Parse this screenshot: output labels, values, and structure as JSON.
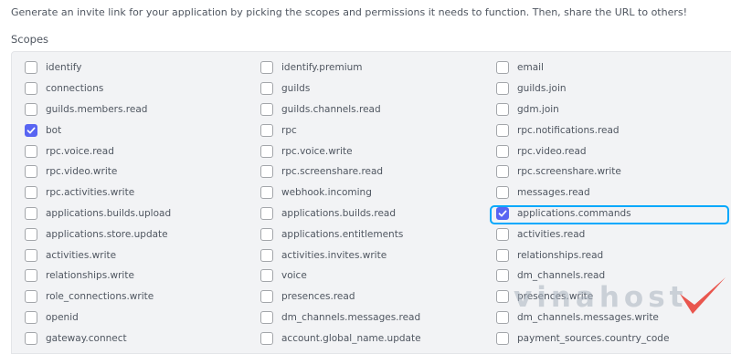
{
  "intro_text": "Generate an invite link for your application by picking the scopes and permissions it needs to function. Then, share the URL to others!",
  "scopes_label": "Scopes",
  "colors": {
    "accent": "#5865f2",
    "focus_ring": "#00a8fc",
    "watermark_check": "#e8453c"
  },
  "scopes": [
    {
      "label": "identify",
      "checked": false
    },
    {
      "label": "identify.premium",
      "checked": false
    },
    {
      "label": "email",
      "checked": false
    },
    {
      "label": "connections",
      "checked": false
    },
    {
      "label": "guilds",
      "checked": false
    },
    {
      "label": "guilds.join",
      "checked": false
    },
    {
      "label": "guilds.members.read",
      "checked": false
    },
    {
      "label": "guilds.channels.read",
      "checked": false
    },
    {
      "label": "gdm.join",
      "checked": false
    },
    {
      "label": "bot",
      "checked": true
    },
    {
      "label": "rpc",
      "checked": false
    },
    {
      "label": "rpc.notifications.read",
      "checked": false
    },
    {
      "label": "rpc.voice.read",
      "checked": false
    },
    {
      "label": "rpc.voice.write",
      "checked": false
    },
    {
      "label": "rpc.video.read",
      "checked": false
    },
    {
      "label": "rpc.video.write",
      "checked": false
    },
    {
      "label": "rpc.screenshare.read",
      "checked": false
    },
    {
      "label": "rpc.screenshare.write",
      "checked": false
    },
    {
      "label": "rpc.activities.write",
      "checked": false
    },
    {
      "label": "webhook.incoming",
      "checked": false
    },
    {
      "label": "messages.read",
      "checked": false
    },
    {
      "label": "applications.builds.upload",
      "checked": false
    },
    {
      "label": "applications.builds.read",
      "checked": false
    },
    {
      "label": "applications.commands",
      "checked": true,
      "highlighted": true
    },
    {
      "label": "applications.store.update",
      "checked": false
    },
    {
      "label": "applications.entitlements",
      "checked": false
    },
    {
      "label": "activities.read",
      "checked": false
    },
    {
      "label": "activities.write",
      "checked": false
    },
    {
      "label": "activities.invites.write",
      "checked": false
    },
    {
      "label": "relationships.read",
      "checked": false
    },
    {
      "label": "relationships.write",
      "checked": false
    },
    {
      "label": "voice",
      "checked": false
    },
    {
      "label": "dm_channels.read",
      "checked": false
    },
    {
      "label": "role_connections.write",
      "checked": false
    },
    {
      "label": "presences.read",
      "checked": false
    },
    {
      "label": "presences.write",
      "checked": false
    },
    {
      "label": "openid",
      "checked": false
    },
    {
      "label": "dm_channels.messages.read",
      "checked": false
    },
    {
      "label": "dm_channels.messages.write",
      "checked": false
    },
    {
      "label": "gateway.connect",
      "checked": false
    },
    {
      "label": "account.global_name.update",
      "checked": false
    },
    {
      "label": "payment_sources.country_code",
      "checked": false
    }
  ],
  "watermark": {
    "text": "vinahost",
    "icon": "checkmark-logo-icon"
  }
}
